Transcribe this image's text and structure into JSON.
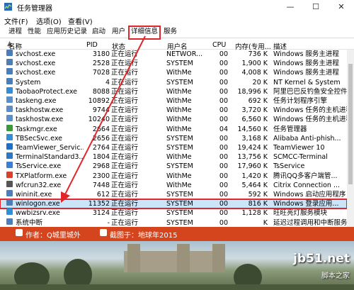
{
  "window": {
    "title": "任务管理器",
    "minimize": "—",
    "maximize": "☐",
    "close": "✕"
  },
  "menu": [
    "文件(F)",
    "选项(O)",
    "查看(V)"
  ],
  "tabs": [
    "进程",
    "性能",
    "应用历史记录",
    "启动",
    "用户",
    "详细信息",
    "服务"
  ],
  "active_tab": "详细信息",
  "columns": {
    "name": "名称",
    "pid": "PID",
    "status": "状态",
    "user": "用户名",
    "cpu": "CPU",
    "mem": "内存(专用...",
    "desc": "描述"
  },
  "rows": [
    {
      "name": "svchost.exe",
      "pid": "3180",
      "status": "正在运行",
      "user": "NETWOR...",
      "cpu": "00",
      "mem": "736 K",
      "desc": "Windows 服务主进程",
      "icon_color": "#4a7ebb"
    },
    {
      "name": "svchost.exe",
      "pid": "2528",
      "status": "正在运行",
      "user": "SYSTEM",
      "cpu": "00",
      "mem": "1,900 K",
      "desc": "Windows 服务主进程",
      "icon_color": "#4a7ebb"
    },
    {
      "name": "svchost.exe",
      "pid": "7028",
      "status": "正在运行",
      "user": "WithMe",
      "cpu": "00",
      "mem": "4,008 K",
      "desc": "Windows 服务主进程",
      "icon_color": "#4a7ebb"
    },
    {
      "name": "System",
      "pid": "4",
      "status": "正在运行",
      "user": "SYSTEM",
      "cpu": "00",
      "mem": "20 K",
      "desc": "NT Kernel & System",
      "icon_color": "#4a7ebb"
    },
    {
      "name": "TaobaoProtect.exe",
      "pid": "8088",
      "status": "正在运行",
      "user": "WithMe",
      "cpu": "00",
      "mem": "18,996 K",
      "desc": "阿里巴巴反钓鱼安全控件",
      "icon_color": "#2f8fd8"
    },
    {
      "name": "taskeng.exe",
      "pid": "10892",
      "status": "正在运行",
      "user": "WithMe",
      "cpu": "00",
      "mem": "692 K",
      "desc": "任务计划程序引擎",
      "icon_color": "#5b8fc7"
    },
    {
      "name": "taskhostw.exe",
      "pid": "9744",
      "status": "正在运行",
      "user": "WithMe",
      "cpu": "00",
      "mem": "3,720 K",
      "desc": "Windows 任务的主机进程",
      "icon_color": "#5b8fc7"
    },
    {
      "name": "taskhostw.exe",
      "pid": "10240",
      "status": "正在运行",
      "user": "WithMe",
      "cpu": "00",
      "mem": "6,560 K",
      "desc": "Windows 任务的主机进程",
      "icon_color": "#5b8fc7"
    },
    {
      "name": "Taskmgr.exe",
      "pid": "2664",
      "status": "正在运行",
      "user": "WithMe",
      "cpu": "04",
      "mem": "14,560 K",
      "desc": "任务管理器",
      "icon_color": "#3a9a3a"
    },
    {
      "name": "TBSecSvc.exe",
      "pid": "2656",
      "status": "正在运行",
      "user": "SYSTEM",
      "cpu": "00",
      "mem": "3,168 K",
      "desc": "Alibaba Anti-phish...",
      "icon_color": "#2f8fd8"
    },
    {
      "name": "TeamViewer_Servic...",
      "pid": "2764",
      "status": "正在运行",
      "user": "SYSTEM",
      "cpu": "00",
      "mem": "19,424 K",
      "desc": "TeamViewer 10",
      "icon_color": "#1e6fc9"
    },
    {
      "name": "TerminalStandard3...",
      "pid": "1804",
      "status": "正在运行",
      "user": "WithMe",
      "cpu": "00",
      "mem": "13,756 K",
      "desc": "SCMCC-Terminal",
      "icon_color": "#2b78c4"
    },
    {
      "name": "TsService.exe",
      "pid": "2968",
      "status": "正在运行",
      "user": "SYSTEM",
      "cpu": "00",
      "mem": "17,960 K",
      "desc": "TsService",
      "icon_color": "#3a7fd0"
    },
    {
      "name": "TXPlatform.exe",
      "pid": "2300",
      "status": "正在运行",
      "user": "WithMe",
      "cpu": "00",
      "mem": "1,420 K",
      "desc": "腾讯QQ多客户端管...",
      "icon_color": "#d8402c"
    },
    {
      "name": "wfcrun32.exe",
      "pid": "7448",
      "status": "正在运行",
      "user": "WithMe",
      "cpu": "00",
      "mem": "5,464 K",
      "desc": "Citrix Connection ...",
      "icon_color": "#555555"
    },
    {
      "name": "wininit.exe",
      "pid": "612",
      "status": "正在运行",
      "user": "SYSTEM",
      "cpu": "00",
      "mem": "592 K",
      "desc": "Windows 启动应用程序",
      "icon_color": "#4a7ebb"
    },
    {
      "name": "winlogon.exe",
      "pid": "11352",
      "status": "正在运行",
      "user": "SYSTEM",
      "cpu": "00",
      "mem": "816 K",
      "desc": "Windows 登录应用...",
      "icon_color": "#4a7ebb",
      "selected": true
    },
    {
      "name": "wwbizsrv.exe",
      "pid": "3124",
      "status": "正在运行",
      "user": "SYSTEM",
      "cpu": "00",
      "mem": "1,128 K",
      "desc": "旺旺亮灯服务模块",
      "icon_color": "#2f8fd8"
    },
    {
      "name": "系统中断",
      "pid": "-",
      "status": "正在运行",
      "user": "SYSTEM",
      "cpu": "00",
      "mem": "K",
      "desc": "延迟过程调用和中断服务",
      "icon_color": "#4a7ebb"
    }
  ],
  "banner": {
    "author_label": "作者：Q城里城外",
    "capture_label": "截图于：地球年2015"
  },
  "watermark": {
    "site": "jb51.net",
    "name": "脚本之家"
  },
  "colors": {
    "highlight": "#e0262a",
    "banner": "#d4451e",
    "selection": "#cce4f7"
  }
}
